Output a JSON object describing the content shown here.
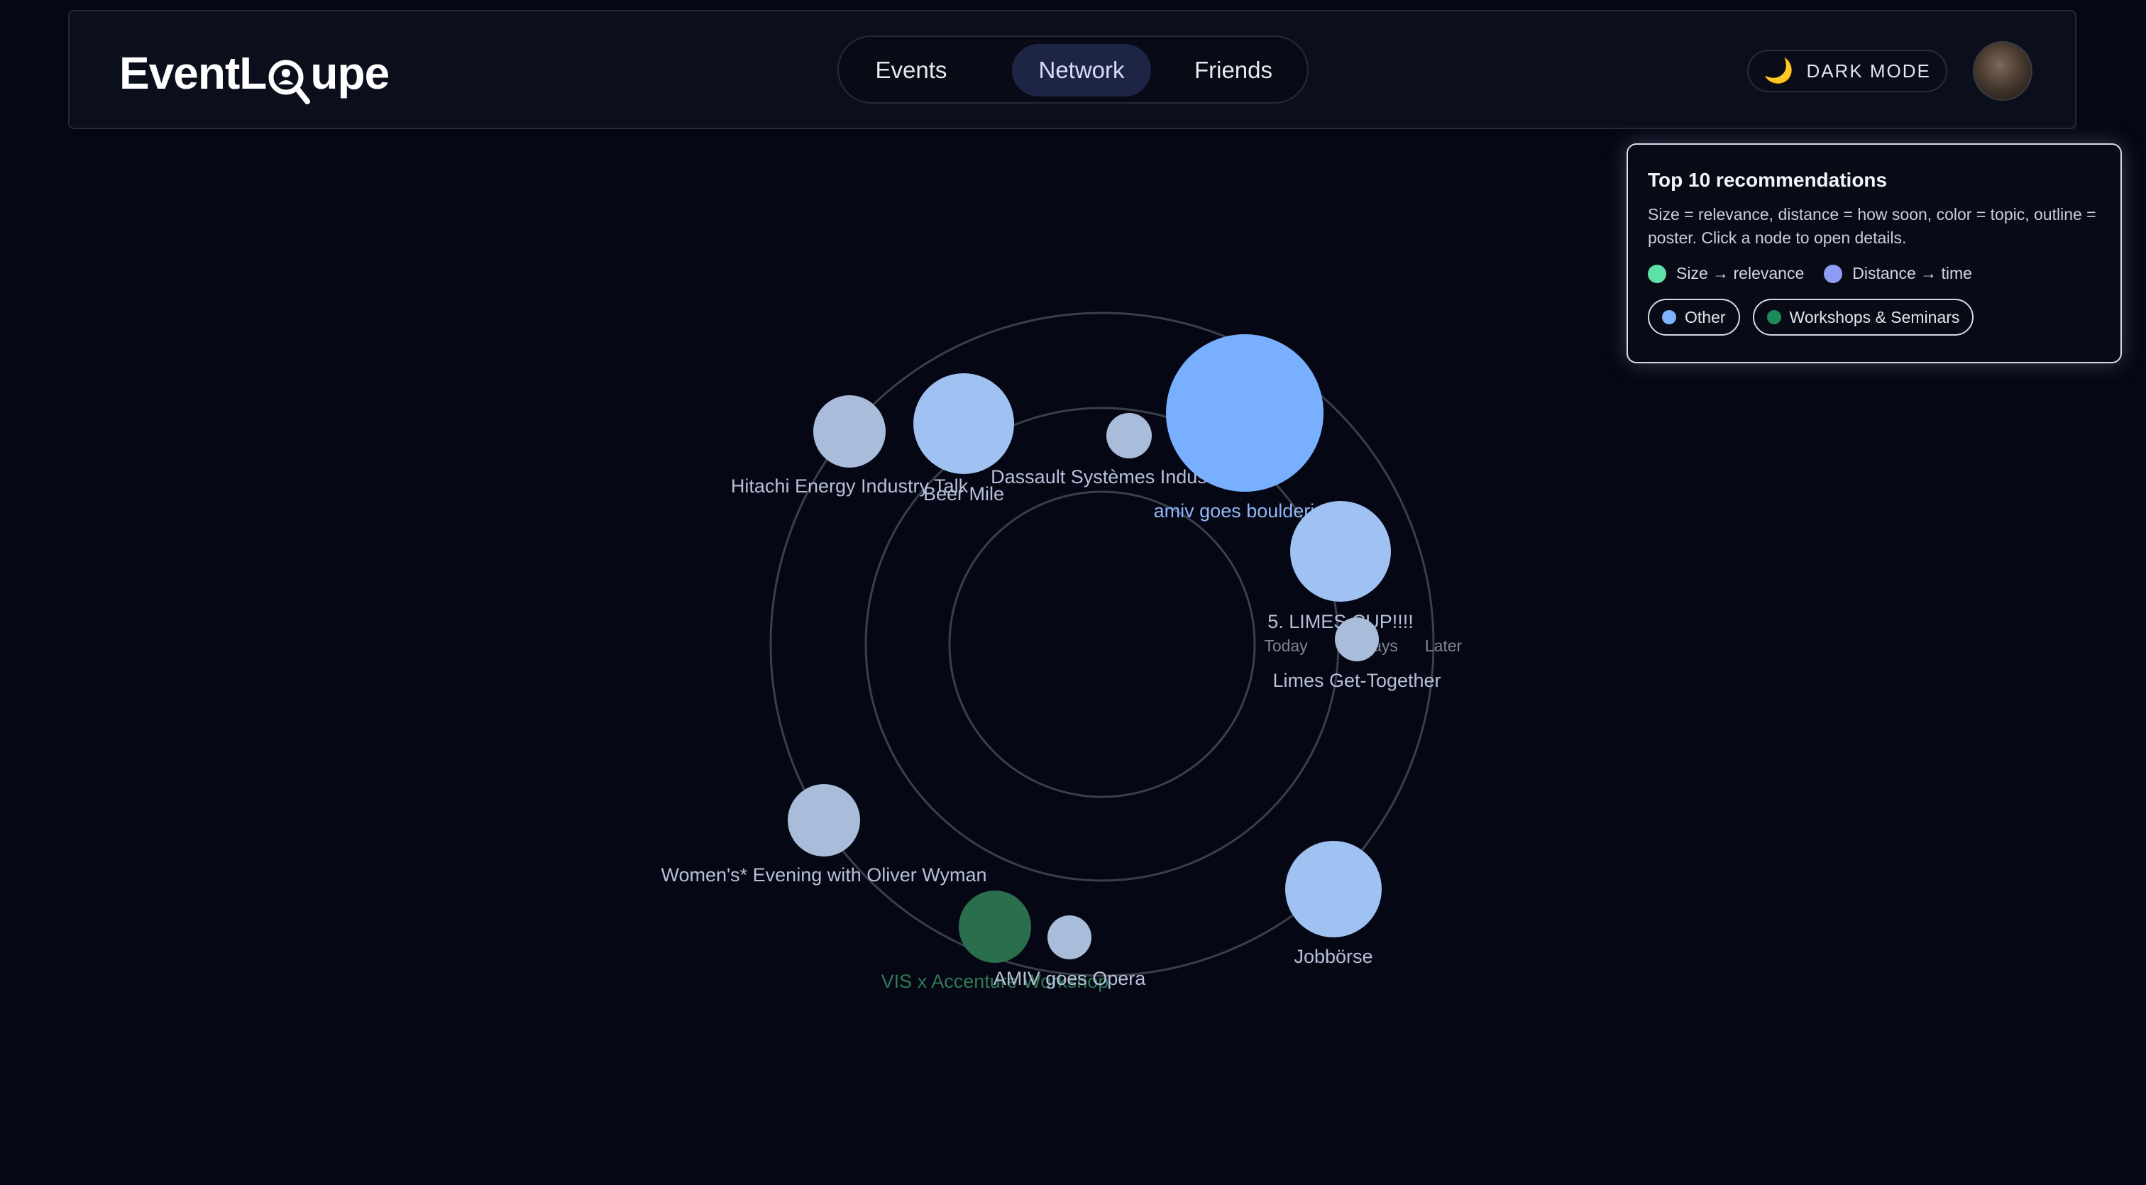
{
  "app": {
    "logo_prefix": "EventL",
    "logo_suffix": "upe"
  },
  "nav": {
    "tabs": [
      {
        "label": "Events",
        "active": false
      },
      {
        "label": "Network",
        "active": true
      },
      {
        "label": "Friends",
        "active": false
      }
    ]
  },
  "header": {
    "theme_toggle_icon": "moon-icon",
    "theme_toggle_label": "DARK MODE"
  },
  "panel": {
    "title": "Top 10 recommendations",
    "description": "Size = relevance, distance = how soon, color = topic, outline = poster. Click a node to open details.",
    "legend": [
      {
        "label": "Size → relevance",
        "color": "#5fe0a6"
      },
      {
        "label": "Distance → time",
        "color": "#8f9cf5"
      }
    ],
    "topics": [
      {
        "label": "Other",
        "color": "#7fb3ff"
      },
      {
        "label": "Workshops & Seminars",
        "color": "#1d8a5a"
      }
    ]
  },
  "graph": {
    "ring_labels": [
      "Today",
      "7 days",
      "Later"
    ],
    "colors": {
      "other": "#9fc2f2",
      "other_bright": "#78b0ff",
      "other_muted": "#a9bcd9",
      "workshop": "#2b6e4d",
      "ring": "#3a3f4c"
    },
    "nodes": [
      {
        "label": "Hitachi Energy Industry Talk",
        "topic": "other"
      },
      {
        "label": "Beer Mile",
        "topic": "other"
      },
      {
        "label": "Dassault Systèmes Industry Talk",
        "topic": "other"
      },
      {
        "label": "amiv goes bouldering",
        "topic": "other"
      },
      {
        "label": "5. LIMES CUP!!!!",
        "topic": "other"
      },
      {
        "label": "Limes Get-Together",
        "topic": "other"
      },
      {
        "label": "Women's* Evening with Oliver Wyman",
        "topic": "other"
      },
      {
        "label": "VIS x Accenture Workshop",
        "topic": "workshop"
      },
      {
        "label": "AMIV goes Opera",
        "topic": "other"
      },
      {
        "label": "Jobbörse",
        "topic": "other"
      }
    ]
  }
}
